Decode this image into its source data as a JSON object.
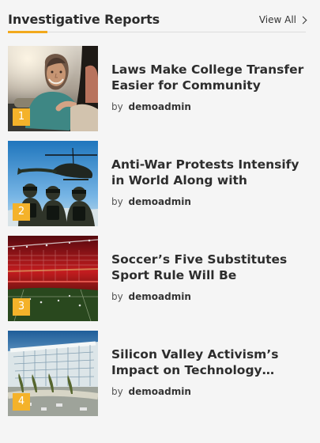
{
  "widget": {
    "title": "Investigative Reports",
    "view_all_label": "View All",
    "view_all_icon": "chevron-right-icon",
    "accent_color": "#f2a91c"
  },
  "articles": [
    {
      "number": "1",
      "headline": "Laws Make College Transfer Easier for Community Colle…",
      "by_label": "by",
      "author": "demoadmin",
      "thumbnail_icon": "woman-smiling-photo"
    },
    {
      "number": "2",
      "headline": "Anti-War Protests Intensify in World Along with Crackdown",
      "by_label": "by",
      "author": "demoadmin",
      "thumbnail_icon": "soldiers-helicopter-photo"
    },
    {
      "number": "3",
      "headline": "Soccer’s Five Substitutes Sport Rule Will Be Permanent",
      "by_label": "by",
      "author": "demoadmin",
      "thumbnail_icon": "soccer-stadium-photo"
    },
    {
      "number": "4",
      "headline": "Silicon Valley Activism’s Impact on Technology…",
      "by_label": "by",
      "author": "demoadmin",
      "thumbnail_icon": "modern-building-photo"
    }
  ]
}
